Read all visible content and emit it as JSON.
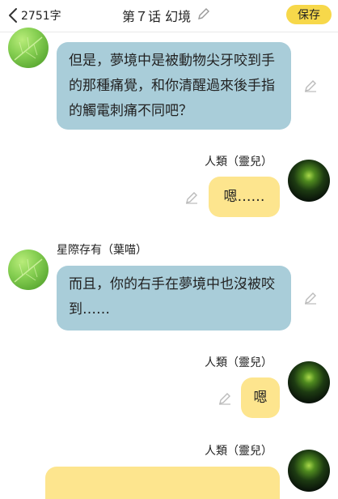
{
  "header": {
    "word_count": "2751字",
    "title": "第７话 幻境",
    "save_label": "保存"
  },
  "messages": [
    {
      "side": "left",
      "text": "但是，夢境中是被動物尖牙咬到手的那種痛覺，和你清醒過來後手指的觸電刺痛不同吧？"
    },
    {
      "side": "right",
      "name": "人類（靈兒）",
      "text": "嗯……"
    },
    {
      "side": "left",
      "name": "星際存有（葉喵）",
      "text": "而且，你的右手在夢境中也沒被咬到……"
    },
    {
      "side": "right",
      "name": "人類（靈兒）",
      "text": "嗯"
    },
    {
      "side": "right",
      "name": "人類（靈兒）",
      "text": ""
    }
  ],
  "colors": {
    "accent_yellow": "#f7d84a",
    "bubble_blue": "#a9cdd9",
    "bubble_yellow": "#fde58e"
  },
  "icons": [
    "chevron-left-icon",
    "pencil-icon",
    "leaf-avatar",
    "planet-avatar"
  ]
}
